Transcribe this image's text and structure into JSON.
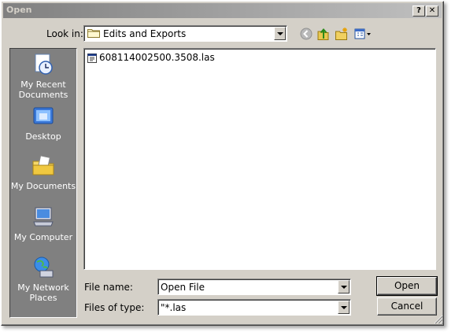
{
  "window": {
    "title": "Open",
    "help_button": "?",
    "close_button": "✕"
  },
  "lookin": {
    "label": "Look in:",
    "value": "Edits and Exports"
  },
  "toolbar": {
    "icons": [
      "back-icon",
      "up-folder-icon",
      "new-folder-icon",
      "view-menu-icon"
    ]
  },
  "places": [
    {
      "label": "My Recent Documents",
      "icon": "recent-documents-icon"
    },
    {
      "label": "Desktop",
      "icon": "desktop-icon"
    },
    {
      "label": "My Documents",
      "icon": "my-documents-icon"
    },
    {
      "label": "My Computer",
      "icon": "my-computer-icon"
    },
    {
      "label": "My Network Places",
      "icon": "network-places-icon"
    }
  ],
  "files": [
    {
      "name": "608114002500.3508.las",
      "icon": "las-file-icon"
    }
  ],
  "filename": {
    "label": "File name:",
    "value": "Open File"
  },
  "filetype": {
    "label": "Files of type:",
    "value": "\"*.las"
  },
  "buttons": {
    "open": "Open",
    "cancel": "Cancel"
  }
}
